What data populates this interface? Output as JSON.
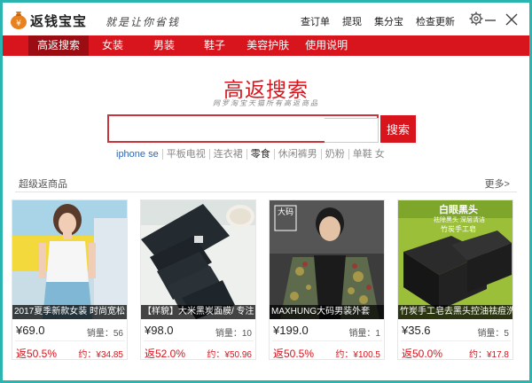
{
  "app": {
    "title": "返钱宝宝",
    "slogan": "就是让你省钱",
    "top_links": [
      "查订单",
      "提现",
      "集分宝",
      "检查更新"
    ]
  },
  "nav": {
    "items": [
      "高返搜索",
      "女装",
      "男装",
      "鞋子",
      "美容护肤",
      "使用说明"
    ],
    "active_index": 0
  },
  "search": {
    "title": "高返搜索",
    "subtitle": "网罗淘宝天猫所有高返商品",
    "input_value": "",
    "button_label": "搜索",
    "hot_words": [
      "iphone se",
      "平板电视",
      "连衣裙",
      "零食",
      "休闲裤男",
      "奶粉",
      "单鞋 女"
    ]
  },
  "section": {
    "title": "超级返商品",
    "more_label": "更多>"
  },
  "products": [
    {
      "caption": "2017夏季新款女装 时尚宽松",
      "price": "¥69.0",
      "sales": "销量：56",
      "rebate": "返50.5%",
      "estimate": "约：¥34.85"
    },
    {
      "caption": "【样貌】大米黑炭面膜/ 专注",
      "price": "¥98.0",
      "sales": "销量：10",
      "rebate": "返52.0%",
      "estimate": "约：¥50.96"
    },
    {
      "caption": "MAXHUNG大码男装外套",
      "price": "¥199.0",
      "sales": "销量：1",
      "rebate": "返50.5%",
      "estimate": "约：¥100.5"
    },
    {
      "caption": "竹炭手工皂去黑头控油祛痘洗",
      "price": "¥35.6",
      "sales": "销量：5",
      "rebate": "返50.0%",
      "estimate": "约：¥17.8"
    }
  ],
  "product_image_text": {
    "p3_badge": "大码",
    "p4_banner_1": "白眼黑头",
    "p4_banner_2": "祛除黑头 深层清洁",
    "p4_banner_3": "竹炭手工皂"
  },
  "colors": {
    "brand_red": "#d8141d",
    "nav_active": "#9c0d13",
    "frame_teal": "#2bb5b0"
  }
}
